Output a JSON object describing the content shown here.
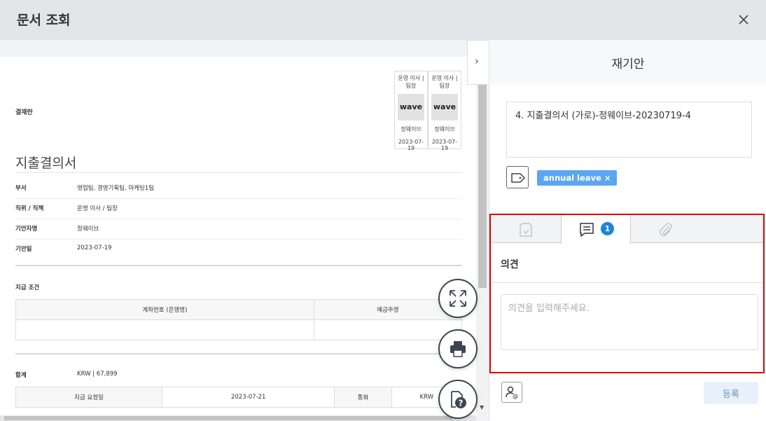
{
  "header": {
    "title": "문서 조회"
  },
  "document": {
    "approval_label": "결재란",
    "approvers": [
      {
        "role": "운영 이사 | 팀장",
        "stamp": "wave",
        "name": "정웨이브",
        "date": "2023-07-19"
      },
      {
        "role": "운영 이사 | 팀장",
        "stamp": "wave",
        "name": "정웨이브",
        "date": "2023-07-19"
      }
    ],
    "title": "지출결의서",
    "info": [
      {
        "key": "부서",
        "value": "영업팀, 경영기획팀, 마케팅1팀"
      },
      {
        "key": "직위 / 직책",
        "value": "운영 이사 / 팀장"
      },
      {
        "key": "기안자명",
        "value": "정웨이브"
      },
      {
        "key": "기안일",
        "value": "2023-07-19"
      }
    ],
    "payment_condition_label": "지급 조건",
    "payment_table_headers": [
      "계좌번호 (은행명)",
      "예금주명"
    ],
    "total_label": "합계",
    "total_value": "KRW | 67,899",
    "request_table": [
      "지급 요청일",
      "2023-07-21",
      "통화",
      "KRW"
    ]
  },
  "sidebar": {
    "title": "재기안",
    "doc_name": "4. 지출결의서 (가로)-정웨이브-20230719-4",
    "tag": "annual leave",
    "tag_remove": "×",
    "comment_badge": "1",
    "comment_label": "의견",
    "comment_placeholder": "의견을 입력해주세요.",
    "submit_label": "등록"
  },
  "icons": {
    "close": "close-icon",
    "expand": "expand-icon",
    "print": "printer-icon",
    "help": "help-document-icon",
    "tag": "tag-icon",
    "approval_tab": "approval-document-icon",
    "comment_tab": "comment-icon",
    "attachment_tab": "paperclip-icon",
    "mention": "mention-user-icon"
  },
  "colors": {
    "accent": "#1d84d8",
    "tag": "#5ba6f2",
    "highlight_border": "#e00000"
  }
}
